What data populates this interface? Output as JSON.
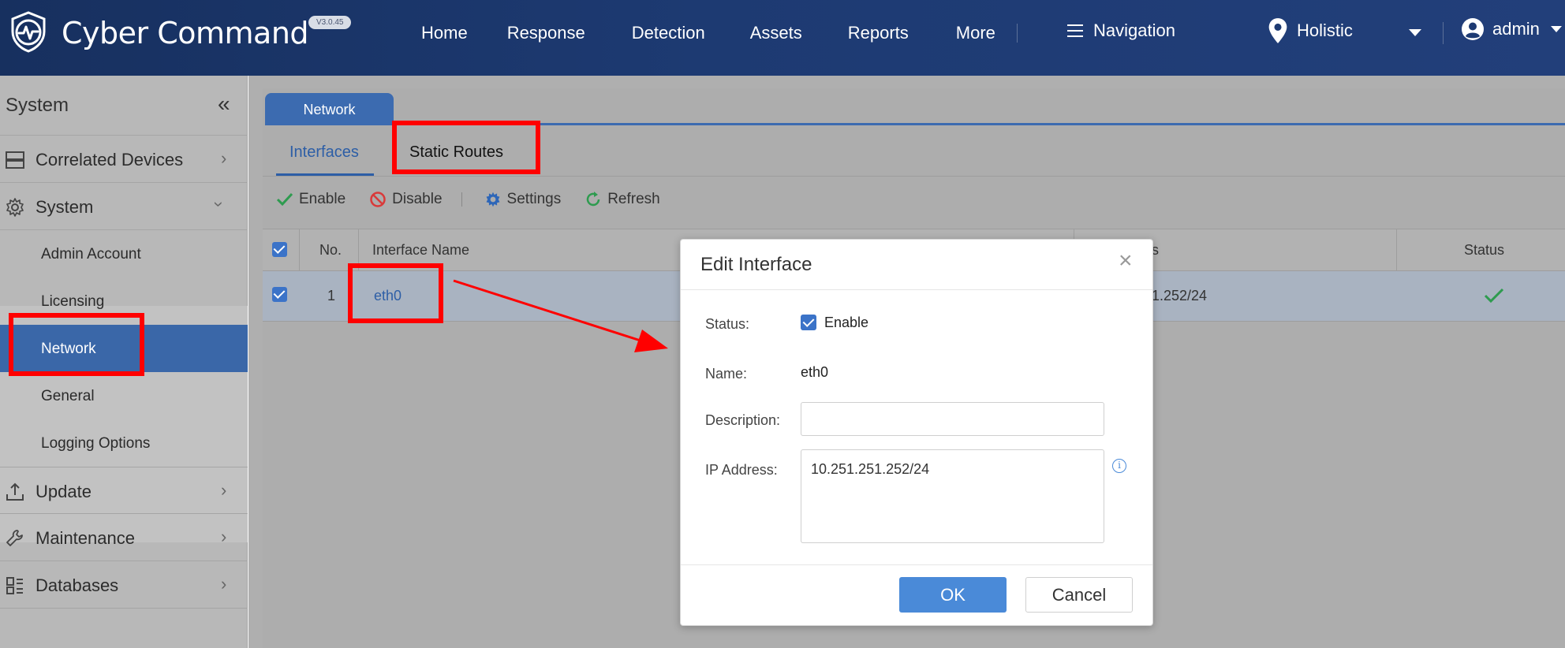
{
  "header": {
    "brand": "Cyber Command",
    "version": "V3.0.45",
    "nav": [
      "Home",
      "Response",
      "Detection",
      "Assets",
      "Reports",
      "More"
    ],
    "navigation_label": "Navigation",
    "view": "Holistic",
    "user": "admin",
    "colors": {
      "bar": "#1d3a72",
      "accent": "#3c6bb0"
    }
  },
  "sidebar": {
    "title": "System",
    "collapse_icon": "«",
    "items": [
      {
        "label": "Correlated Devices",
        "icon": "server-icon"
      },
      {
        "label": "System",
        "icon": "gear-icon",
        "expanded": true,
        "children": [
          "Admin Account",
          "Licensing",
          "Network",
          "General",
          "Logging Options"
        ],
        "active_child": "Network"
      },
      {
        "label": "Update",
        "icon": "upload-icon"
      },
      {
        "label": "Maintenance",
        "icon": "wrench-icon"
      },
      {
        "label": "Databases",
        "icon": "dashboard-icon"
      }
    ]
  },
  "page": {
    "tab": "Network",
    "subtabs": [
      "Interfaces",
      "Static Routes"
    ],
    "active_subtab": "Interfaces",
    "toolbar": [
      "Enable",
      "Disable",
      "Settings",
      "Refresh"
    ],
    "table": {
      "columns": [
        "No.",
        "Interface Name",
        "s",
        "Status"
      ],
      "rows": [
        {
          "no": "1",
          "name": "eth0",
          "ip_partial": "1.252/24",
          "status": "enabled"
        }
      ]
    }
  },
  "dialog": {
    "title": "Edit Interface",
    "close": "×",
    "status_label": "Status:",
    "status_value": "Enable",
    "name_label": "Name:",
    "name_value": "eth0",
    "description_label": "Description:",
    "description_value": "",
    "ip_label": "IP Address:",
    "ip_value": "10.251.251.252/24",
    "info": "i",
    "ok": "OK",
    "cancel": "Cancel"
  },
  "annotation_color": "#ff0000"
}
